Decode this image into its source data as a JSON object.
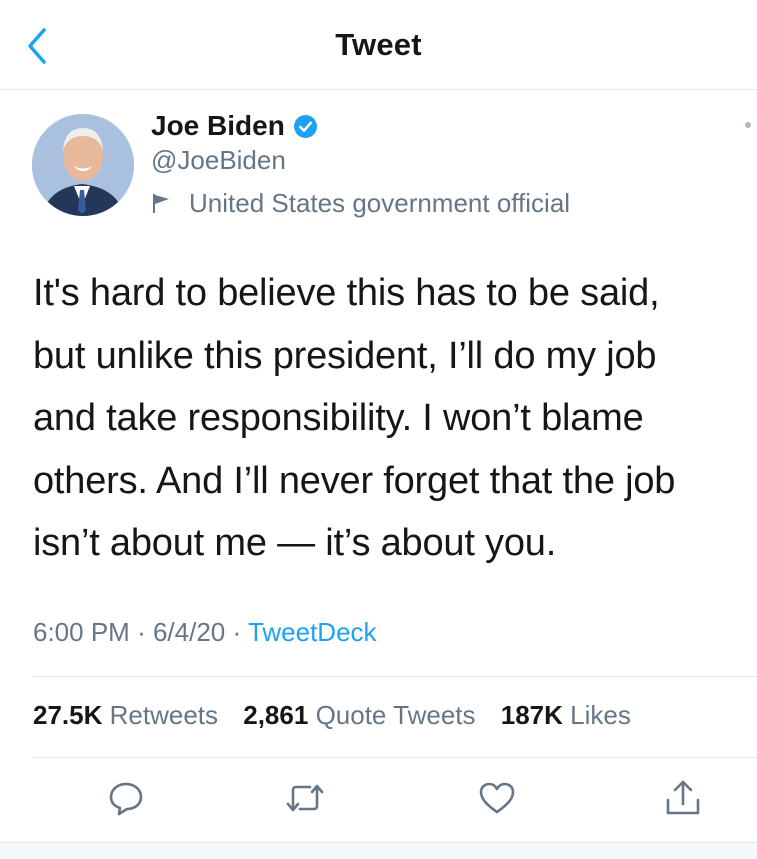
{
  "header": {
    "title": "Tweet",
    "back_icon": "chevron-left-icon"
  },
  "author": {
    "name": "Joe Biden",
    "handle": "@JoeBiden",
    "verified": true,
    "label": "United States government official",
    "label_icon": "flag-icon"
  },
  "tweet": {
    "lines": [
      "It's hard to believe this has to be said,",
      "but unlike this president, I’ll do my job",
      "and take responsibility. I won’t blame",
      "others. And I’ll never forget that the job",
      "isn’t about me — it’s about you."
    ],
    "time": "6:00 PM",
    "separator": "·",
    "date": "6/4/20",
    "source": "TweetDeck"
  },
  "stats": {
    "retweets_count": "27.5K",
    "retweets_label": "Retweets",
    "quotes_count": "2,861",
    "quotes_label": "Quote Tweets",
    "likes_count": "187K",
    "likes_label": "Likes"
  },
  "actions": [
    "reply-icon",
    "retweet-icon",
    "like-icon",
    "share-icon"
  ],
  "colors": {
    "accent": "#1da1f2",
    "secondary_text": "#657786",
    "primary_text": "#14171a",
    "divider": "#e1e8ed"
  }
}
